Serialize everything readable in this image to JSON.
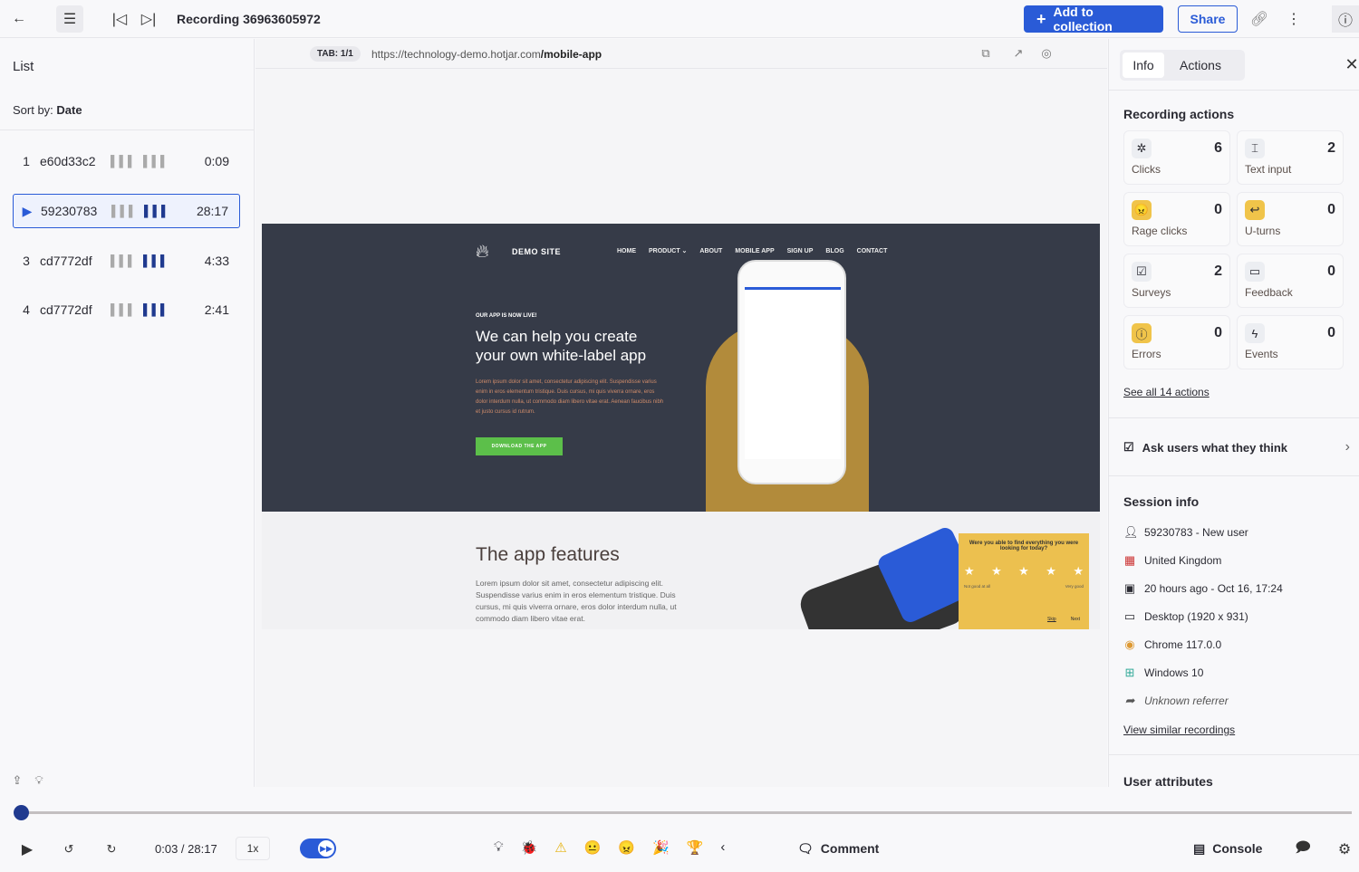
{
  "header": {
    "title": "Recording 36963605972",
    "add_to_collection": "Add to collection",
    "share": "Share"
  },
  "left": {
    "title": "List",
    "sort_label": "Sort by:",
    "sort_value": "Date",
    "rows": [
      {
        "index": "1",
        "id": "e60d33c2",
        "duration": "0:09"
      },
      {
        "index": "",
        "id": "59230783",
        "duration": "28:17",
        "selected": true
      },
      {
        "index": "3",
        "id": "cd7772df",
        "duration": "4:33"
      },
      {
        "index": "4",
        "id": "cd7772df",
        "duration": "2:41"
      }
    ]
  },
  "address": {
    "tab": "TAB: 1/1",
    "url_base": "https://technology-demo.hotjar.com",
    "url_path": "/mobile-app"
  },
  "site": {
    "brand": "DEMO SITE",
    "nav": [
      "HOME",
      "PRODUCT ⌄",
      "ABOUT",
      "MOBILE APP",
      "SIGN UP",
      "BLOG",
      "CONTACT"
    ],
    "kicker": "OUR APP IS NOW LIVE!",
    "headline1": "We can help you create",
    "headline2": "your own white-label app",
    "body": "Lorem ipsum dolor sit amet, consectetur adipiscing elit. Suspendisse varius enim in eros elementum tristique. Duis cursus, mi quis viverra ornare, eros dolor interdum nulla, ut commodo diam libero vitae erat. Aenean faucibus nibh et justo cursus id rutrum.",
    "cta": "DOWNLOAD THE APP",
    "features_title": "The app features",
    "features_body": "Lorem ipsum dolor sit amet, consectetur adipiscing elit. Suspendisse varius enim in eros elementum tristique. Duis cursus, mi quis viverra ornare, eros dolor interdum nulla, ut commodo diam libero vitae erat.",
    "survey_q": "Were you able to find everything you were looking for today?",
    "survey_low": "Not good at all",
    "survey_high": "Very good",
    "survey_skip": "Skip",
    "survey_next": "Next"
  },
  "right": {
    "tabs": [
      "Info",
      "Actions"
    ],
    "recording_actions": "Recording actions",
    "actions": [
      {
        "label": "Clicks",
        "count": "6",
        "icon": "✲"
      },
      {
        "label": "Text input",
        "count": "2",
        "icon": "⌶"
      },
      {
        "label": "Rage clicks",
        "count": "0",
        "icon": "😠"
      },
      {
        "label": "U-turns",
        "count": "0",
        "icon": "↩"
      },
      {
        "label": "Surveys",
        "count": "2",
        "icon": "☑"
      },
      {
        "label": "Feedback",
        "count": "0",
        "icon": "▭"
      },
      {
        "label": "Errors",
        "count": "0",
        "icon": "ⓘ"
      },
      {
        "label": "Events",
        "count": "0",
        "icon": "ϟ"
      }
    ],
    "see_all": "See all 14 actions",
    "ask_users": "Ask users what they think",
    "session_info": "Session info",
    "session": [
      {
        "icon": "user",
        "text": "59230783 - New user"
      },
      {
        "icon": "flag-uk",
        "text": "United Kingdom"
      },
      {
        "icon": "calendar",
        "text": "20 hours ago - Oct 16, 17:24"
      },
      {
        "icon": "monitor",
        "text": "Desktop (1920 x 931)"
      },
      {
        "icon": "chrome",
        "text": "Chrome 117.0.0"
      },
      {
        "icon": "windows",
        "text": "Windows 10"
      },
      {
        "icon": "share",
        "text": "Unknown referrer"
      }
    ],
    "view_similar": "View similar recordings",
    "user_attributes": "User attributes"
  },
  "player": {
    "time": "0:03 / 28:17",
    "speed": "1x",
    "comment": "Comment",
    "console": "Console",
    "progress_percent": 0.2,
    "skip_inactivity": true
  },
  "colors": {
    "accent": "#2a5bd7",
    "site_dark": "#363b48",
    "survey": "#ecc04f",
    "cta": "#5cbf4a"
  }
}
